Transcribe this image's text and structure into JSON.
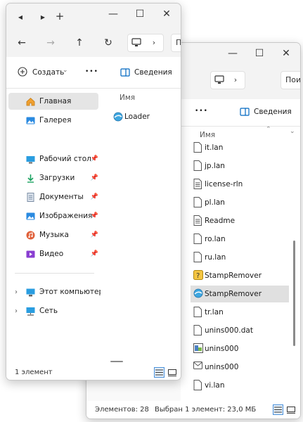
{
  "colors": {
    "accent": "#0067c0",
    "selected_row": "#e0e0e0",
    "selected_nav": "#e5e5e5",
    "chrome": "#f3f3f3"
  },
  "front_window": {
    "command_bar": {
      "create_label": "Создать",
      "more_label": "•••",
      "details_label": "Сведения"
    },
    "nav": {
      "home": "Главная",
      "gallery": "Галерея",
      "pinned": [
        "Рабочий стол",
        "Загрузки",
        "Документы",
        "Изображения",
        "Музыка",
        "Видео"
      ],
      "this_pc": "Этот компьютер",
      "network": "Сеть"
    },
    "column_header": "Имя",
    "files": [
      "Loader"
    ],
    "status": "1 элемент"
  },
  "back_window": {
    "address_partial": "Пои",
    "command_bar": {
      "more_label": "•••",
      "details_label": "Сведения"
    },
    "column_header": "Имя",
    "files": [
      {
        "name": "it.lan",
        "icon": "document-icon"
      },
      {
        "name": "jp.lan",
        "icon": "document-icon"
      },
      {
        "name": "license-rln",
        "icon": "text-document-icon"
      },
      {
        "name": "pl.lan",
        "icon": "document-icon"
      },
      {
        "name": "Readme",
        "icon": "text-document-icon"
      },
      {
        "name": "ro.lan",
        "icon": "document-icon"
      },
      {
        "name": "ru.lan",
        "icon": "document-icon"
      },
      {
        "name": "StampRemover",
        "icon": "help-file-icon"
      },
      {
        "name": "StampRemover",
        "icon": "app-icon"
      },
      {
        "name": "tr.lan",
        "icon": "document-icon"
      },
      {
        "name": "unins000.dat",
        "icon": "document-icon"
      },
      {
        "name": "unins000",
        "icon": "uninstaller-icon"
      },
      {
        "name": "unins000",
        "icon": "mail-icon"
      },
      {
        "name": "vi.lan",
        "icon": "document-icon"
      }
    ],
    "selected_index": 8,
    "status_count": "Элементов: 28",
    "status_selected": "Выбран 1 элемент: 23,0 МБ"
  }
}
